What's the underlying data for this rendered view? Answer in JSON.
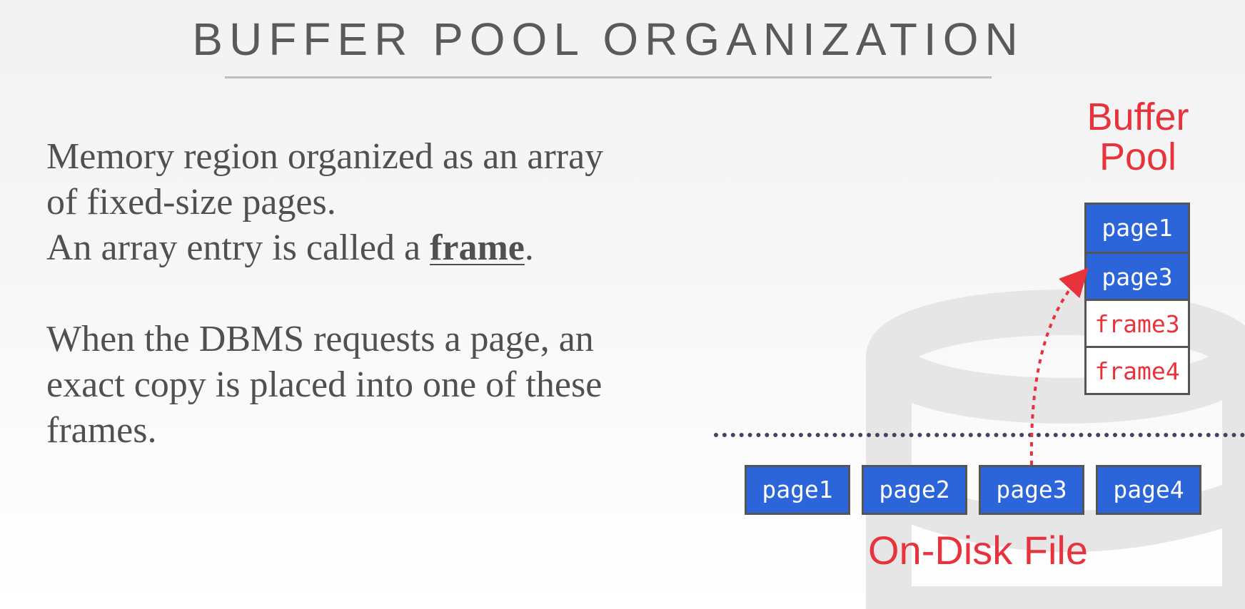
{
  "title": "BUFFER POOL ORGANIZATION",
  "paragraphs": {
    "p1_line1": "Memory region organized as an array",
    "p1_line2": "of fixed-size pages.",
    "p1_line3_pre": "An array entry is called a ",
    "p1_keyword": "frame",
    "p1_line3_post": ".",
    "p2_line1": "When the DBMS requests a page, an",
    "p2_line2": "exact copy is placed into one of these",
    "p2_line3": "frames."
  },
  "buffer_pool": {
    "label_line1": "Buffer",
    "label_line2": "Pool",
    "frames": [
      {
        "label": "page1",
        "state": "filled"
      },
      {
        "label": "page3",
        "state": "filled"
      },
      {
        "label": "frame3",
        "state": "empty"
      },
      {
        "label": "frame4",
        "state": "empty"
      }
    ]
  },
  "disk": {
    "label": "On-Disk File",
    "pages": [
      "page1",
      "page2",
      "page3",
      "page4"
    ]
  },
  "colors": {
    "accent_red": "#e8323c",
    "page_blue": "#2b65d9",
    "divider": "#434360",
    "title_gray": "#5a5a5a"
  }
}
